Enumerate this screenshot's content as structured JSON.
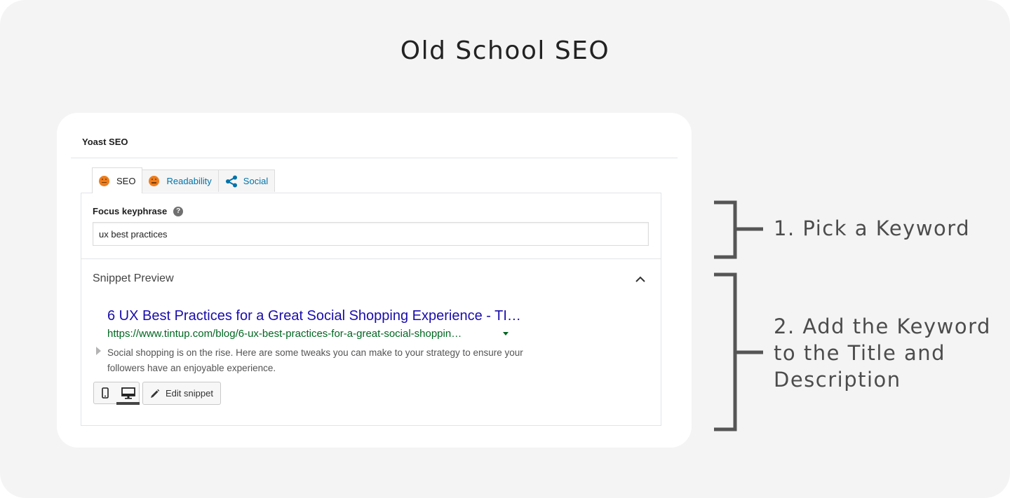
{
  "page_title": "Old School SEO",
  "card": {
    "heading": "Yoast SEO",
    "tabs": [
      {
        "label": "SEO",
        "icon": "orange-face-icon",
        "active": true
      },
      {
        "label": "Readability",
        "icon": "orange-face-icon",
        "active": false
      },
      {
        "label": "Social",
        "icon": "share-icon",
        "active": false
      }
    ],
    "focus": {
      "label": "Focus keyphrase",
      "help_glyph": "?",
      "value": "ux best practices"
    },
    "snippet": {
      "header": "Snippet Preview",
      "title": "6 UX Best Practices for a Great Social Shopping Experience - TI…",
      "url": "https://www.tintup.com/blog/6-ux-best-practices-for-a-great-social-shoppin…",
      "description": "Social shopping is on the rise. Here are some tweaks you can make to your strategy to ensure your followers have an enjoyable experience.",
      "edit_label": "Edit snippet"
    }
  },
  "annotations": {
    "step1": "1. Pick a Keyword",
    "step2_line1": "2. Add the Keyword",
    "step2_line2": "to the Title and",
    "step2_line3": "Description"
  },
  "colors": {
    "accent_link": "#0073aa",
    "serp_title": "#1a0dab",
    "serp_url": "#006621",
    "face": "#ee7c1b"
  }
}
